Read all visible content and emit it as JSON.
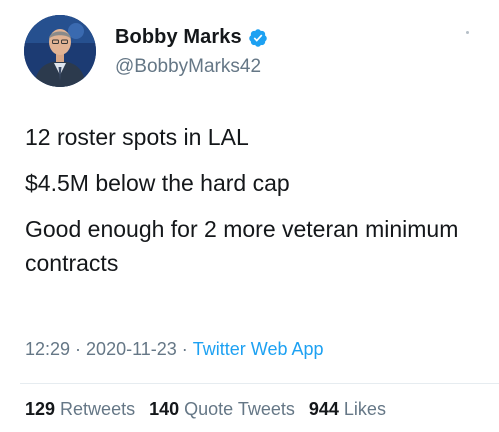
{
  "tweet": {
    "author": {
      "display_name": "Bobby Marks",
      "handle": "@BobbyMarks42",
      "verified": true,
      "avatar": "avatar-photo"
    },
    "lines": [
      "12 roster spots in LAL",
      "$4.5M below the hard cap",
      "Good enough for 2 more veteran minimum contracts"
    ],
    "time": "12:29",
    "date": "2020-11-23",
    "separator": "·",
    "source": "Twitter Web App",
    "stats": {
      "retweets_count": "129",
      "retweets_label": "Retweets",
      "quotes_count": "140",
      "quotes_label": "Quote Tweets",
      "likes_count": "944",
      "likes_label": "Likes"
    }
  },
  "colors": {
    "text": "#14171a",
    "secondary": "#657786",
    "link": "#1da1f2",
    "verified": "#1da1f2",
    "divider": "#e6ecf0"
  },
  "icons": {
    "verified": "verified-badge-icon",
    "more": "more-options-icon"
  }
}
